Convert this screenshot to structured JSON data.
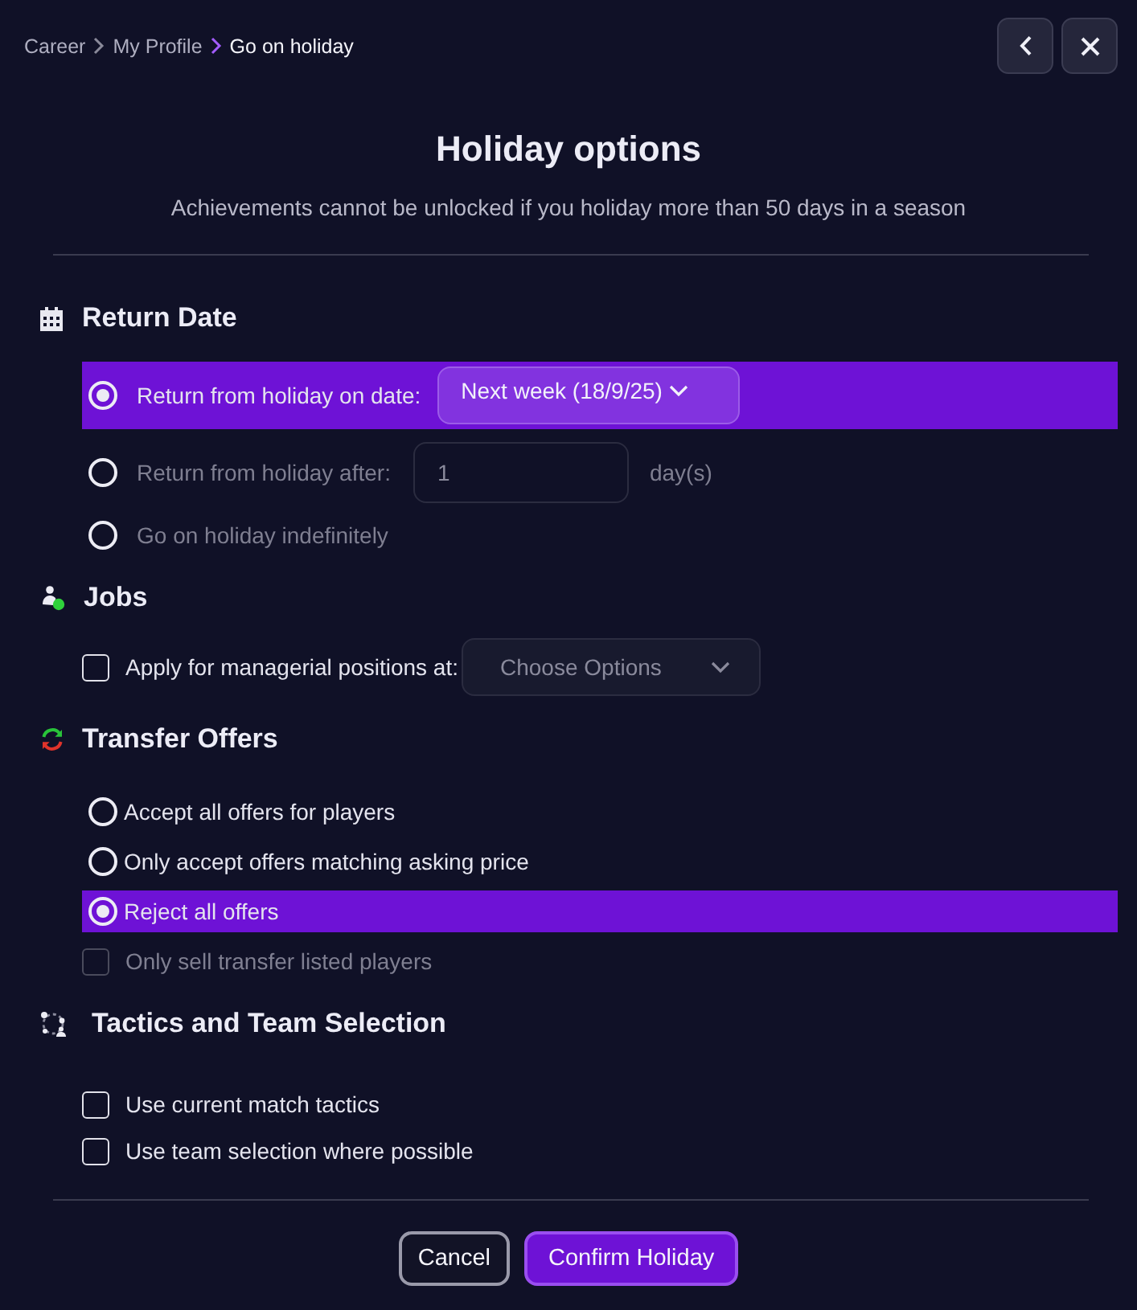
{
  "breadcrumb": [
    {
      "label": "Career",
      "selected": false
    },
    {
      "label": "My Profile",
      "selected": false
    },
    {
      "label": "Go on holiday",
      "selected": true
    }
  ],
  "title": "Holiday options",
  "subtitle": "Achievements cannot be unlocked if you holiday more than 50 days in a season",
  "sections": [
    {
      "kind": "date",
      "title": "Return Date",
      "options": [
        {
          "kind": "radio",
          "label": "Return from holiday on date:",
          "selected": true,
          "disabled": false,
          "control": {
            "kind": "dropdown",
            "value": "Next week (18/9/25)"
          }
        },
        {
          "kind": "radio",
          "label": "Return from holiday after:",
          "selected": false,
          "disabled": true,
          "control": {
            "kind": "number",
            "value": "1",
            "unit": "day(s)"
          }
        },
        {
          "kind": "radio",
          "label": "Go on holiday indefinitely",
          "selected": false,
          "disabled": true
        }
      ]
    },
    {
      "kind": "jobs",
      "title": "Jobs",
      "options": [
        {
          "kind": "checkbox",
          "label": "Apply for managerial positions at:",
          "checked": false,
          "disabled": false,
          "control": {
            "kind": "dropdown",
            "placeholder": "Choose Options"
          }
        }
      ]
    },
    {
      "kind": "transfers",
      "title": "Transfer Offers",
      "options": [
        {
          "kind": "radio",
          "label": "Accept all offers for players",
          "selected": false,
          "disabled": false
        },
        {
          "kind": "radio",
          "label": "Only accept offers matching asking price",
          "selected": false,
          "disabled": false
        },
        {
          "kind": "radio",
          "label": "Reject all offers",
          "selected": true,
          "disabled": false
        },
        {
          "kind": "checkbox",
          "label": "Only sell transfer listed players",
          "checked": false,
          "disabled": true
        }
      ]
    },
    {
      "kind": "tactics",
      "title": "Tactics and Team Selection",
      "options": [
        {
          "kind": "checkbox",
          "label": "Use current match tactics",
          "checked": false,
          "disabled": false
        },
        {
          "kind": "checkbox",
          "label": "Use team selection where possible",
          "checked": false,
          "disabled": false
        }
      ]
    }
  ],
  "buttons": [
    {
      "kind": "secondary",
      "label": "Cancel"
    },
    {
      "kind": "primary",
      "label": "Confirm Holiday"
    }
  ]
}
